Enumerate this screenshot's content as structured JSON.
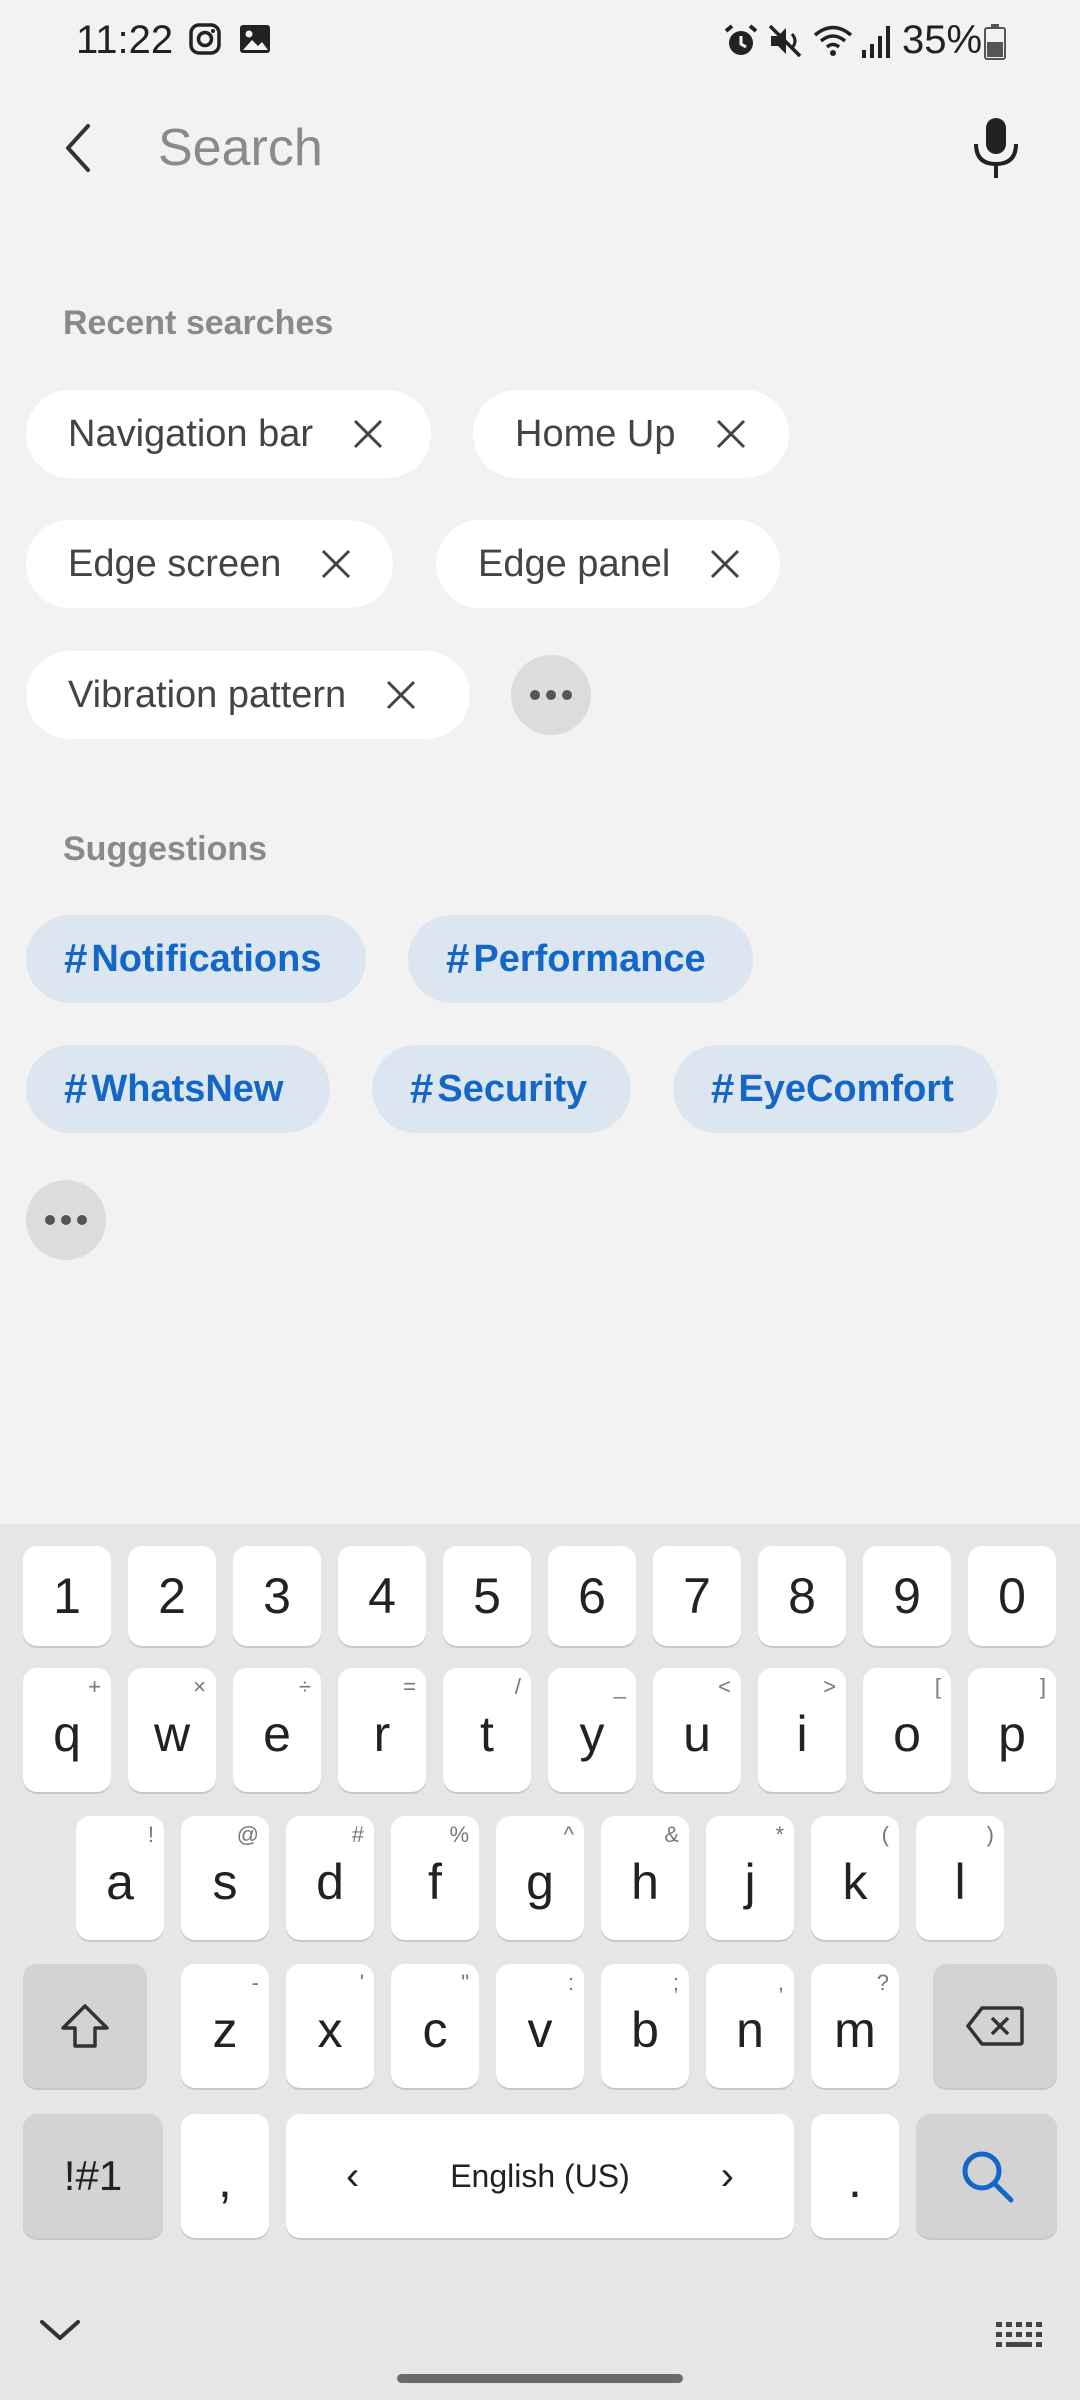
{
  "status_bar": {
    "time": "11:22",
    "battery_percent": "35%",
    "icons": [
      "instagram-icon",
      "gallery-icon",
      "alarm-icon",
      "mute-icon",
      "wifi-icon",
      "signal-icon",
      "battery-icon"
    ]
  },
  "search": {
    "placeholder": "Search",
    "value": ""
  },
  "recent": {
    "title": "Recent searches",
    "items": [
      "Navigation bar",
      "Home Up",
      "Edge screen",
      "Edge panel",
      "Vibration pattern"
    ]
  },
  "suggestions": {
    "title": "Suggestions",
    "hash": "#",
    "items": [
      "Notifications",
      "Performance",
      "WhatsNew",
      "Security",
      "EyeComfort"
    ]
  },
  "keyboard": {
    "number_row": [
      "1",
      "2",
      "3",
      "4",
      "5",
      "6",
      "7",
      "8",
      "9",
      "0"
    ],
    "row1": [
      {
        "k": "q",
        "s": "+"
      },
      {
        "k": "w",
        "s": "×"
      },
      {
        "k": "e",
        "s": "÷"
      },
      {
        "k": "r",
        "s": "="
      },
      {
        "k": "t",
        "s": "/"
      },
      {
        "k": "y",
        "s": "_"
      },
      {
        "k": "u",
        "s": "<"
      },
      {
        "k": "i",
        "s": ">"
      },
      {
        "k": "o",
        "s": "["
      },
      {
        "k": "p",
        "s": "]"
      }
    ],
    "row2": [
      {
        "k": "a",
        "s": "!"
      },
      {
        "k": "s",
        "s": "@"
      },
      {
        "k": "d",
        "s": "#"
      },
      {
        "k": "f",
        "s": "%"
      },
      {
        "k": "g",
        "s": "^"
      },
      {
        "k": "h",
        "s": "&"
      },
      {
        "k": "j",
        "s": "*"
      },
      {
        "k": "k",
        "s": "("
      },
      {
        "k": "l",
        "s": ")"
      }
    ],
    "row3": [
      {
        "k": "z",
        "s": "-"
      },
      {
        "k": "x",
        "s": "'"
      },
      {
        "k": "c",
        "s": "\""
      },
      {
        "k": "v",
        "s": ":"
      },
      {
        "k": "b",
        "s": ";"
      },
      {
        "k": "n",
        "s": ","
      },
      {
        "k": "m",
        "s": "?"
      }
    ],
    "symbols_key": "!#1",
    "comma_key": ",",
    "space_label": "English (US)",
    "space_left": "‹",
    "space_right": "›",
    "period_key": "."
  },
  "colors": {
    "accent": "#1467c7",
    "tag_bg": "#dbe6f0",
    "background": "#f2f2f2"
  }
}
